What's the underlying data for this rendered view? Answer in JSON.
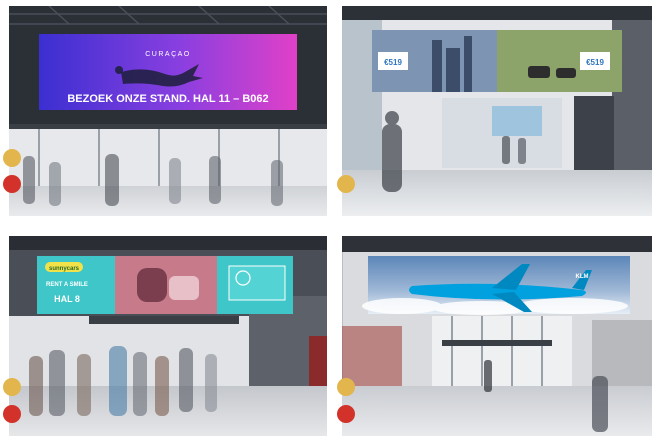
{
  "panels": [
    {
      "billboard": {
        "logo": "CURAÇAO",
        "headline": "BEZOEK ONZE STAND. HAL 11 – B062"
      }
    },
    {
      "billboard": {
        "price_left": "€519",
        "price_right": "€519"
      }
    },
    {
      "billboard": {
        "brand": "sunnycars",
        "line1": "RENT A SMILE",
        "line2": "HAL 8"
      }
    },
    {
      "billboard": {
        "tail_logo": "KLM"
      }
    }
  ],
  "colors": {
    "dot_gold": "#e2b64c",
    "dot_red": "#d2322a",
    "curacao_blue": "#3b2fd1",
    "curacao_pink": "#e040c8",
    "sunny_teal": "#3ec6c8",
    "klm_blue": "#00a1de"
  }
}
